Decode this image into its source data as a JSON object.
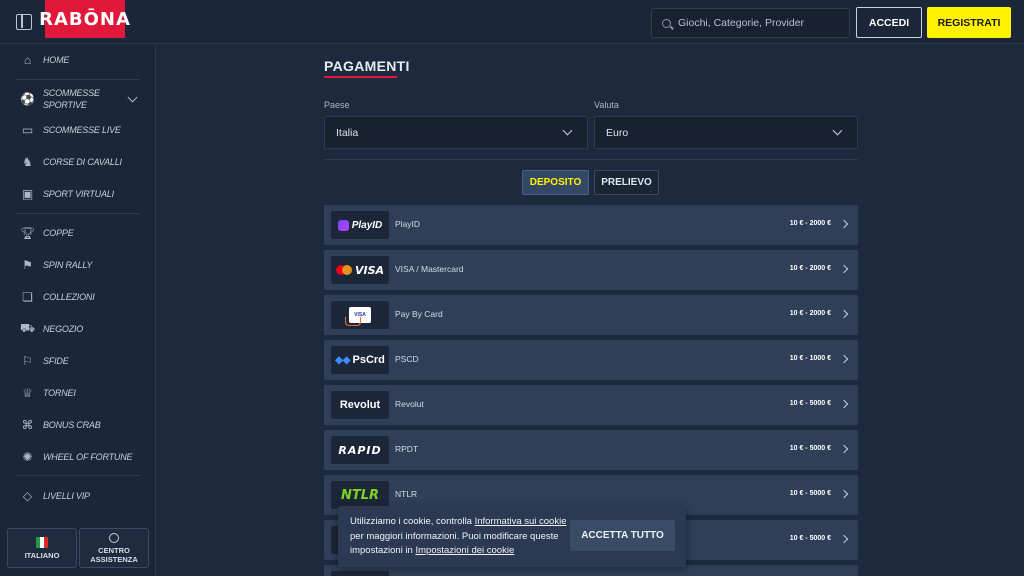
{
  "header": {
    "logo_text": "RABŌNA",
    "search_placeholder": "Giochi, Categorie, Provider",
    "login_label": "ACCEDI",
    "register_label": "REGISTRATI"
  },
  "sidebar": {
    "items": [
      {
        "label": "HOME",
        "icon": "home-icon"
      },
      {
        "label": "SCOMMESSE SPORTIVE",
        "icon": "ball-icon"
      },
      {
        "label": "SCOMMESSE LIVE",
        "icon": "live-icon"
      },
      {
        "label": "CORSE DI CAVALLI",
        "icon": "horse-icon"
      },
      {
        "label": "SPORT VIRTUALI",
        "icon": "virtual-icon"
      },
      {
        "label": "COPPE",
        "icon": "trophy-icon"
      },
      {
        "label": "SPIN RALLY",
        "icon": "flag-checkered-icon"
      },
      {
        "label": "COLLEZIONI",
        "icon": "collection-icon"
      },
      {
        "label": "NEGOZIO",
        "icon": "cart-icon"
      },
      {
        "label": "SFIDE",
        "icon": "flag-icon"
      },
      {
        "label": "TORNEI",
        "icon": "cup-icon"
      },
      {
        "label": "BONUS CRAB",
        "icon": "crab-icon"
      },
      {
        "label": "WHEEL OF FORTUNE",
        "icon": "wheel-icon"
      },
      {
        "label": "LIVELLI VIP",
        "icon": "diamond-icon"
      }
    ],
    "language_label": "ITALIANO",
    "support_label_1": "CENTRO",
    "support_label_2": "ASSISTENZA"
  },
  "main": {
    "title": "PAGAMENTI",
    "country_label": "Paese",
    "country_value": "Italia",
    "currency_label": "Valuta",
    "currency_value": "Euro",
    "tabs": [
      {
        "label": "DEPOSITO",
        "active": true
      },
      {
        "label": "PRELIEVO",
        "active": false
      }
    ],
    "methods": [
      {
        "name": "PlayID",
        "logo": "PlayID",
        "limits": "10 € - 2000 €"
      },
      {
        "name": "VISA / Mastercard",
        "logo": "VISA",
        "limits": "10 € - 2000 €"
      },
      {
        "name": "Pay By Card",
        "logo": "VISA",
        "limits": "10 € - 2000 €"
      },
      {
        "name": "PSCD",
        "logo": "PsCrd",
        "limits": "10 € - 1000 €"
      },
      {
        "name": "Revolut",
        "logo": "Revolut",
        "limits": "10 € - 5000 €"
      },
      {
        "name": "RPDT",
        "logo": "RAPID",
        "limits": "10 € - 5000 €"
      },
      {
        "name": "NTLR",
        "logo": "NTLR",
        "limits": "10 € - 5000 €"
      },
      {
        "name": "",
        "logo": "",
        "limits": "10 € - 5000 €"
      }
    ]
  },
  "cookie": {
    "text_1": "Utilizziamo i cookie, controlla ",
    "link_1": "Informativa sui cookie",
    "text_2": " per maggiori informazioni. Puoi modificare queste impostazioni in ",
    "link_2": "Impostazioni dei cookie",
    "accept_label": "ACCETTA TUTTO"
  },
  "colors": {
    "accent_red": "#e2183a",
    "accent_yellow": "#fff200",
    "background": "#1d2a3d",
    "row": "#2f3f58"
  }
}
